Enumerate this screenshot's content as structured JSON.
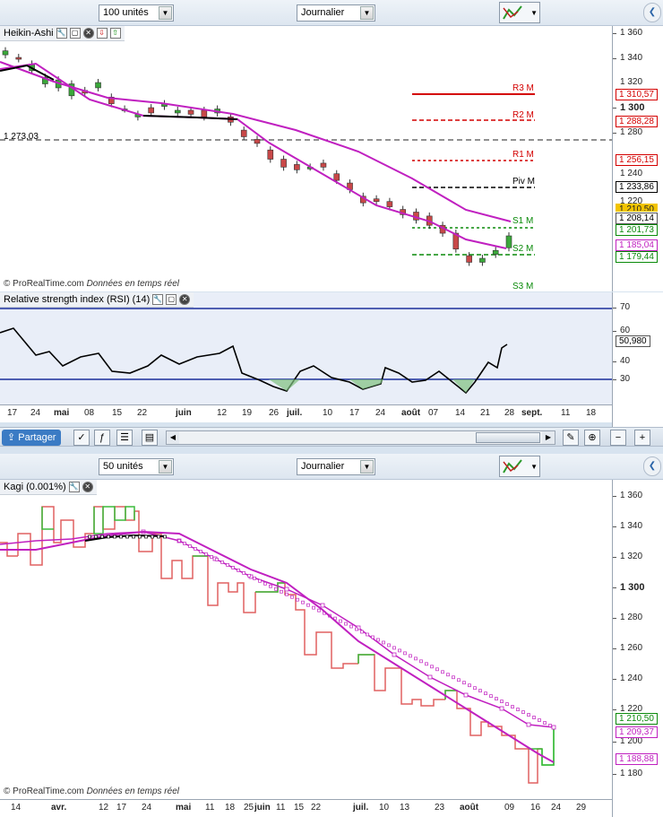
{
  "top_toolbar": {
    "units": "100 unités",
    "timeframe": "Journalier"
  },
  "top_chart": {
    "title": "Heikin-Ashi",
    "left_price_label": "1 273,03",
    "pivots": [
      {
        "name": "R3 M",
        "value": "1 310,57",
        "color": "#d40000"
      },
      {
        "name": "R2 M",
        "value": "1 288,28",
        "color": "#d40000"
      },
      {
        "name": "R1 M",
        "value": "1 256,15",
        "color": "#d40000"
      },
      {
        "name": "Piv M",
        "value": "1 233,86",
        "color": "#000000"
      },
      {
        "name": "S1 M",
        "value": "1 201,73",
        "color": "#0a8a0a"
      },
      {
        "name": "S2 M",
        "value": "1 179,44",
        "color": "#0a8a0a"
      },
      {
        "name": "S3 M",
        "value": "",
        "color": "#0a8a0a"
      }
    ],
    "axis_ticks": [
      "1 360",
      "1 340",
      "1 300",
      "1 280",
      "1 240",
      "1 220"
    ],
    "axis_tick_partial": "1 320",
    "price_labels": {
      "last_partial": "1 210,50",
      "close": "1 208,14",
      "ma": "1 185,04"
    },
    "credit_brand": "© ProRealTime.com",
    "credit_text": "Données en temps réel",
    "series": {
      "ma_short_color": "#000000",
      "ma_long_color": "#c020c0",
      "bull_color": "#3aa83a",
      "bear_color": "#c84848"
    }
  },
  "rsi": {
    "title": "Relative strength index (RSI) (14)",
    "levels": [
      "70",
      "60",
      "40",
      "30"
    ],
    "value": "50,980"
  },
  "top_xaxis": [
    "17",
    "24",
    "mai",
    "08",
    "15",
    "22",
    "juin",
    "12",
    "19",
    "26",
    "juil.",
    "10",
    "17",
    "24",
    "août",
    "07",
    "14",
    "21",
    "28",
    "sept.",
    "11",
    "18"
  ],
  "bar": {
    "share_label": "Partager"
  },
  "bottom_toolbar": {
    "units": "50 unités",
    "timeframe": "Journalier"
  },
  "bottom_chart": {
    "title": "Kagi (0.001%)",
    "axis_ticks": [
      "1 360",
      "1 340",
      "1 320",
      "1 300",
      "1 280",
      "1 260",
      "1 240",
      "1 220",
      "1 200",
      "1 180"
    ],
    "price_labels": {
      "last": "1 210,50",
      "ma_long": "1 209,37",
      "ma_short": "1 188,88"
    },
    "credit_brand": "© ProRealTime.com",
    "credit_text": "Données en temps réel"
  },
  "bottom_xaxis": [
    "14",
    "avr.",
    "12",
    "17",
    "24",
    "mai",
    "11",
    "18",
    "25",
    "juin",
    "11",
    "15",
    "22",
    "juil.",
    "10",
    "13",
    "23",
    "août",
    "09",
    "16",
    "24",
    "29"
  ]
}
